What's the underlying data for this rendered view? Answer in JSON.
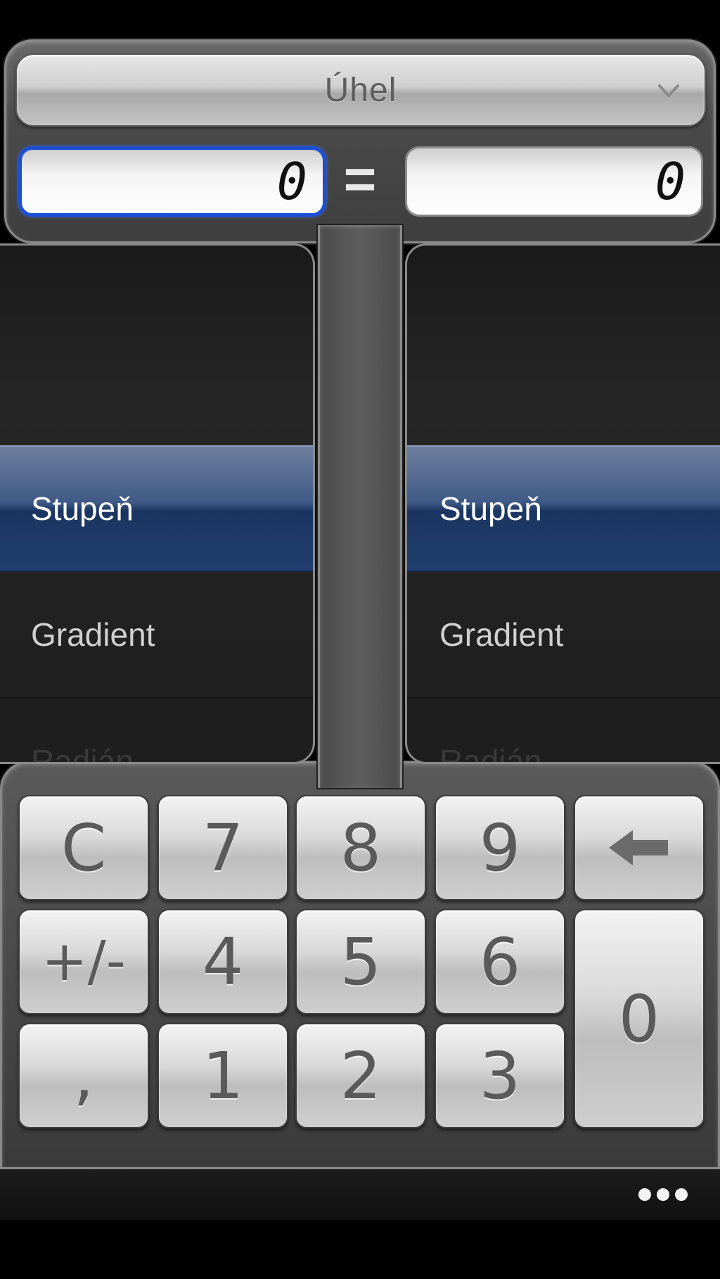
{
  "category": {
    "selected": "Úhel"
  },
  "conversion": {
    "input_value": "0",
    "equals": "=",
    "output_value": "0"
  },
  "from_units": {
    "items": [
      {
        "label": "Stupeň",
        "selected": true
      },
      {
        "label": "Gradient",
        "selected": false
      },
      {
        "label": "Radián",
        "selected": false
      }
    ]
  },
  "to_units": {
    "items": [
      {
        "label": "Stupeň",
        "selected": true
      },
      {
        "label": "Gradient",
        "selected": false
      },
      {
        "label": "Radián",
        "selected": false
      }
    ]
  },
  "keypad": {
    "clear": "C",
    "seven": "7",
    "eight": "8",
    "nine": "9",
    "sign": "+/-",
    "four": "4",
    "five": "5",
    "six": "6",
    "decimal": ",",
    "one": "1",
    "two": "2",
    "three": "3",
    "zero": "0"
  },
  "icons": {
    "backspace": "left-arrow-icon",
    "more": "ellipsis-icon",
    "dropdown": "chevron-down-icon"
  },
  "colors": {
    "accent_focus": "#1a4fd6",
    "selected_row": "#213e6e"
  }
}
